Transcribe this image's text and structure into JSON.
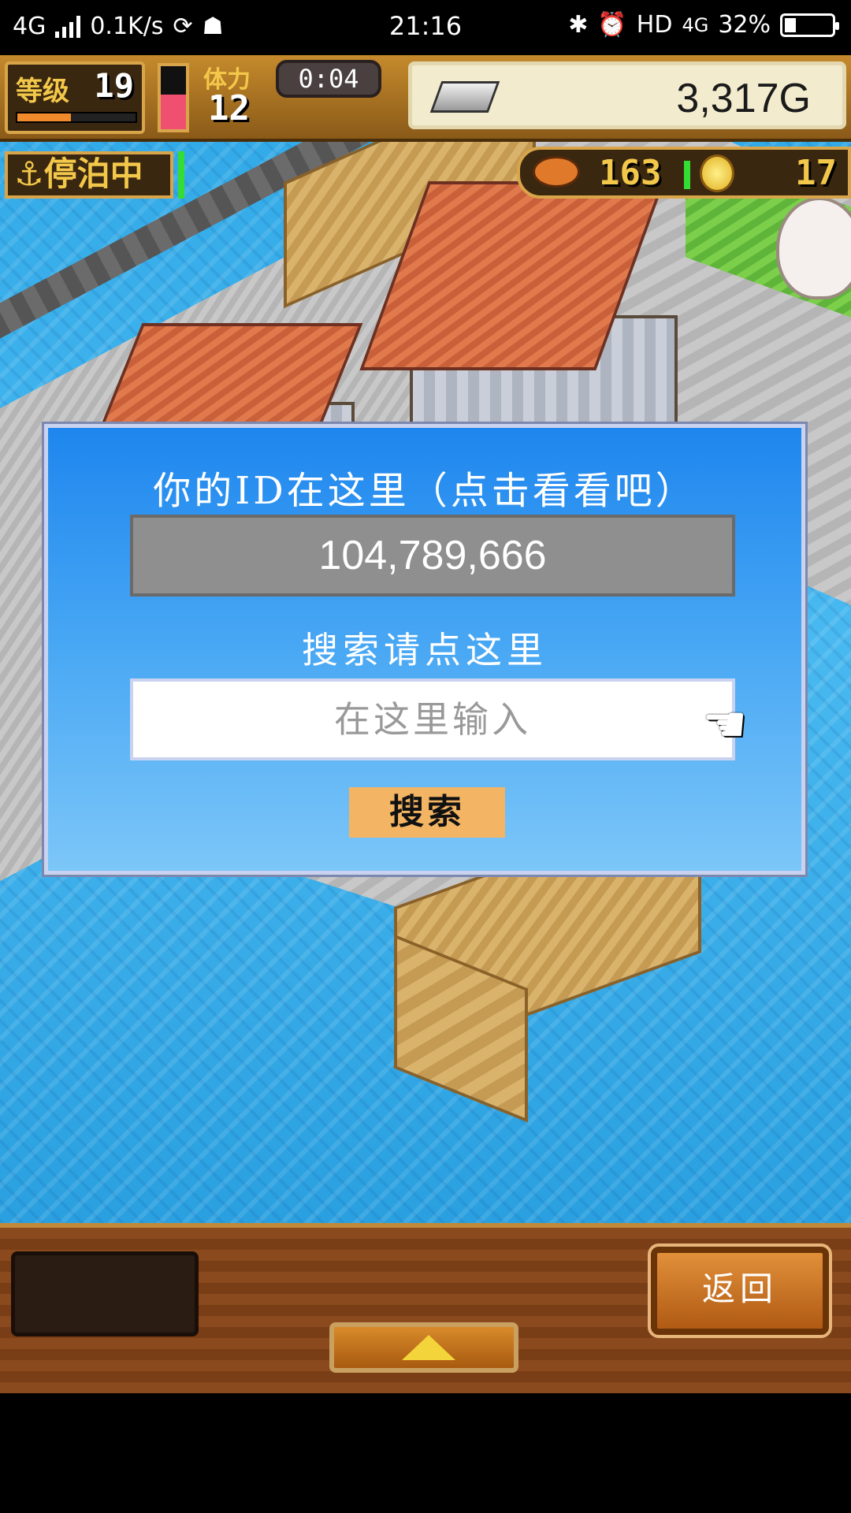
{
  "status_bar": {
    "network": "4G",
    "speed": "0.1K/s",
    "time": "21:16",
    "hd": "HD",
    "network_right": "4G",
    "battery": "32%",
    "battery_level": 0.32
  },
  "hud": {
    "level_label": "等级",
    "level": "19",
    "exp_fraction": 0.45,
    "stamina_label": "体力",
    "stamina": "12",
    "stamina_fraction": 0.55,
    "timer": "0:04",
    "gold": "3,317G",
    "berth_status": "⚓停泊中",
    "food": "163",
    "medals": "17"
  },
  "dialog": {
    "title": "你的ID在这里（点击看看吧）",
    "player_id": "104,789,666",
    "search_label": "搜索请点这里",
    "search_placeholder": "在这里输入",
    "search_button": "搜索"
  },
  "bottom_bar": {
    "back_button": "返回"
  },
  "colors": {
    "dialog_top": "#1e86ee",
    "dialog_bottom": "#7cc6f8",
    "search_button": "#f3b463",
    "gold_text": "#f3c84a"
  }
}
